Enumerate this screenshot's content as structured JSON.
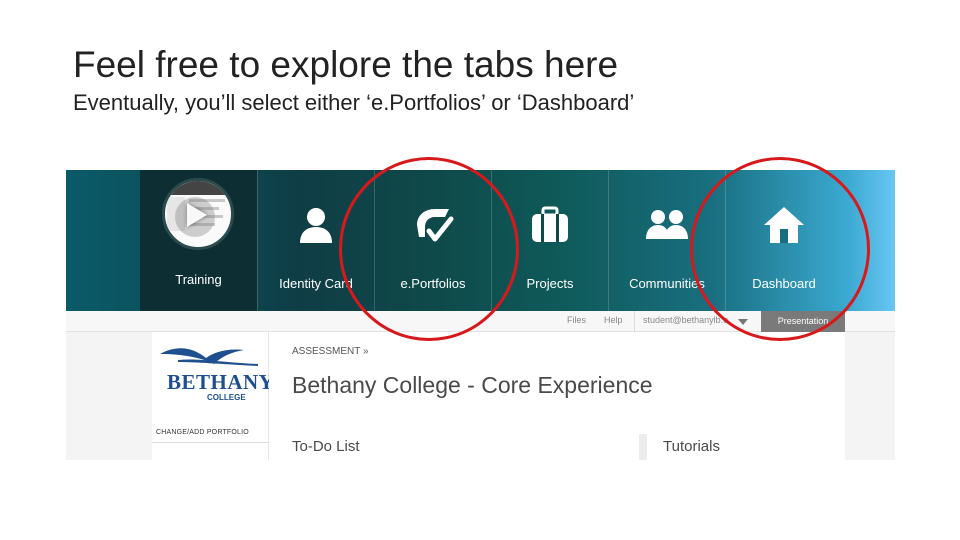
{
  "slide": {
    "title": "Feel free to explore the tabs here",
    "subtitle": "Eventually, you’ll select either ‘e.Portfolios’ or ‘Dashboard’"
  },
  "nav": {
    "tabs": [
      {
        "label": "Training",
        "icon": "training-video-thumbnail"
      },
      {
        "label": "Identity Card",
        "icon": "person-icon"
      },
      {
        "label": "e.Portfolios",
        "icon": "portfolio-check-icon"
      },
      {
        "label": "Projects",
        "icon": "briefcase-icon"
      },
      {
        "label": "Communities",
        "icon": "group-icon"
      },
      {
        "label": "Dashboard",
        "icon": "home-icon"
      }
    ],
    "training_thumb_text": "s. W"
  },
  "toolbar": {
    "files": "Files",
    "help": "Help",
    "email": "student@bethanylb.e",
    "presentation": "Presentation"
  },
  "sidebar": {
    "logo_word": "BETHANY",
    "logo_sub": "COLLEGE",
    "change_link": "CHANGE/ADD PORTFOLIO"
  },
  "main": {
    "breadcrumb": "ASSESSMENT  »",
    "heading": "Bethany College - Core Experience",
    "todo": "To-Do List",
    "tutorials": "Tutorials"
  },
  "colors": {
    "highlight": "#d7191c",
    "nav_dark": "#0f3d45",
    "nav_light": "#67c6f2",
    "logo_blue": "#1f4f8e"
  }
}
